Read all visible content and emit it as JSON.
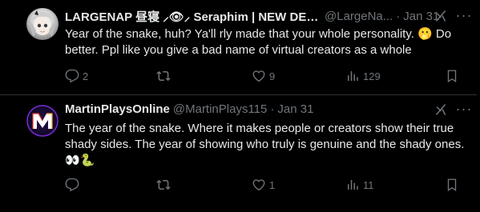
{
  "tweets": [
    {
      "display_name": "LARGENAP 昼寝 ⸝👁⸝ Seraphim | NEW DEB...",
      "handle": "@LargeNa...",
      "separator": "·",
      "time": "Jan 31",
      "text": "Year of the snake, huh? Ya'll rly made that your whole personality. 🫢 Do better. Ppl like you give a bad name of virtual creators as a whole",
      "replies": "2",
      "retweets": "",
      "likes": "9",
      "views": "129"
    },
    {
      "display_name": "MartinPlaysOnline",
      "handle": "@MartinPlays115",
      "separator": "·",
      "time": "Jan 31",
      "text": "The year of the snake. Where it makes people or creators show their true shady sides. The year of showing who truly is genuine and the shady ones. 👀🐍",
      "replies": "",
      "retweets": "",
      "likes": "1",
      "views": "11"
    }
  ],
  "colors": {
    "background": "#000000",
    "text_primary": "#e7e9ea",
    "text_secondary": "#71767b",
    "divider": "#2f3336"
  },
  "icons": {
    "more": "more-options-icon",
    "grok": "grok-icon",
    "reply": "reply-icon",
    "retweet": "retweet-icon",
    "like": "like-icon",
    "views": "views-icon",
    "bookmark": "bookmark-icon",
    "avatar_2_logo": "m-logo"
  }
}
